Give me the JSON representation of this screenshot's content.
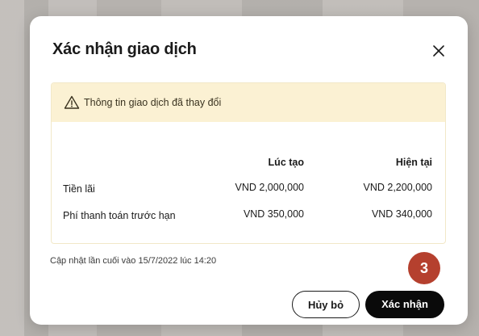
{
  "dialog": {
    "title": "Xác nhận giao dịch",
    "close_icon": "close-icon"
  },
  "warning": {
    "icon": "warning-triangle-icon",
    "text": "Thông tin giao dịch đã thay đổi",
    "background_color": "#fbf1d3"
  },
  "table": {
    "headers": [
      "",
      "Lúc tạo",
      "Hiện tại"
    ],
    "rows": [
      {
        "label": "Tiền lãi",
        "created": "VND 2,000,000",
        "current": "VND 2,200,000"
      },
      {
        "label": "Phí thanh toán trước hạn",
        "created": "VND 350,000",
        "current": "VND 340,000"
      }
    ]
  },
  "footer": {
    "last_updated": "Cập nhật lần cuối vào 15/7/2022 lúc 14:20"
  },
  "step_badge": {
    "number": "3",
    "color": "#b5402e"
  },
  "buttons": {
    "cancel_label": "Hủy bỏ",
    "confirm_label": "Xác nhận"
  }
}
